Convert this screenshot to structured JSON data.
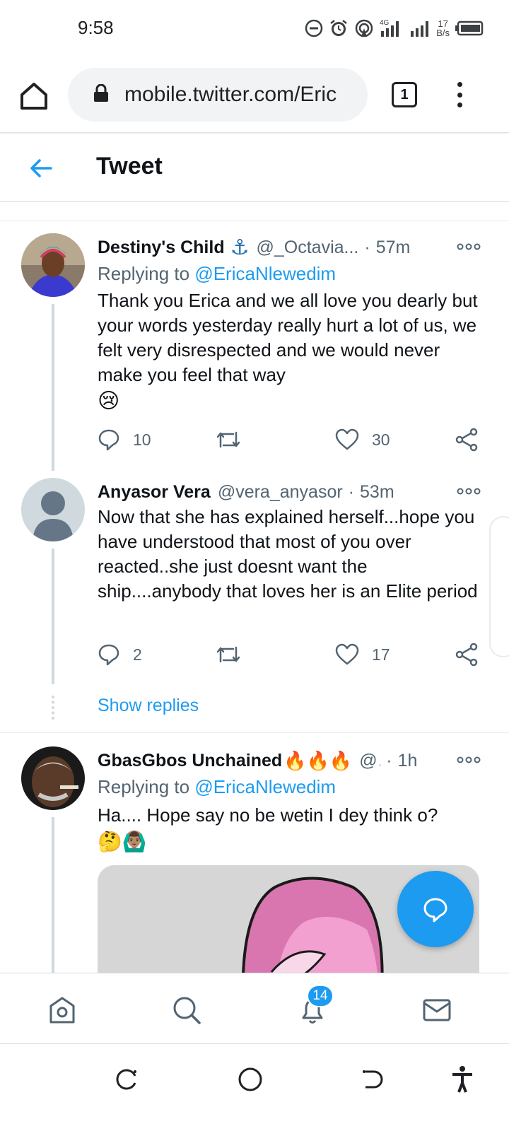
{
  "status_bar": {
    "time": "9:58",
    "network": "4G",
    "speed_value": "17",
    "speed_unit": "B/s",
    "icons": [
      "do-not-disturb-icon",
      "alarm-icon",
      "hotspot-icon",
      "signal-icon",
      "signal-icon",
      "battery-icon"
    ]
  },
  "browser": {
    "url": "mobile.twitter.com/Eric",
    "tab_count": "1"
  },
  "header": {
    "title": "Tweet"
  },
  "tweets": [
    {
      "name": "Destiny's Child",
      "name_emoji": "⚓",
      "handle": "@_Octavia...",
      "time": "57m",
      "replying_prefix": "Replying to ",
      "replying_to": "@EricaNlewedim",
      "text": "Thank you Erica and we all love you dearly but your words yesterday really hurt a lot of us, we felt very disrespected and we would never make you feel that way",
      "emoji": "😢",
      "replies": "10",
      "retweets": "",
      "likes": "30"
    },
    {
      "name": "Anyasor Vera",
      "handle": "@vera_anyasor",
      "time": "53m",
      "text": "Now that she has explained herself...hope you have understood that most of you over reacted..she just doesnt want the ship....anybody that loves her is an Elite period",
      "replies": "2",
      "retweets": "",
      "likes": "17"
    },
    {
      "name": "GbasGbos Unchained",
      "name_emoji": "🔥🔥🔥",
      "handle": "@.",
      "time": "1h",
      "replying_prefix": "Replying to ",
      "replying_to": "@EricaNlewedim",
      "text": "Ha.... Hope say no be wetin I dey think o?",
      "emoji": "🤔🙆🏽‍♂️"
    }
  ],
  "show_replies": "Show replies",
  "tabbar": {
    "items": [
      "home",
      "search",
      "notifications",
      "messages"
    ],
    "notification_badge": "14"
  },
  "colors": {
    "accent": "#1d9bf0",
    "secondary_text": "#536471",
    "border": "#cfd9de"
  }
}
